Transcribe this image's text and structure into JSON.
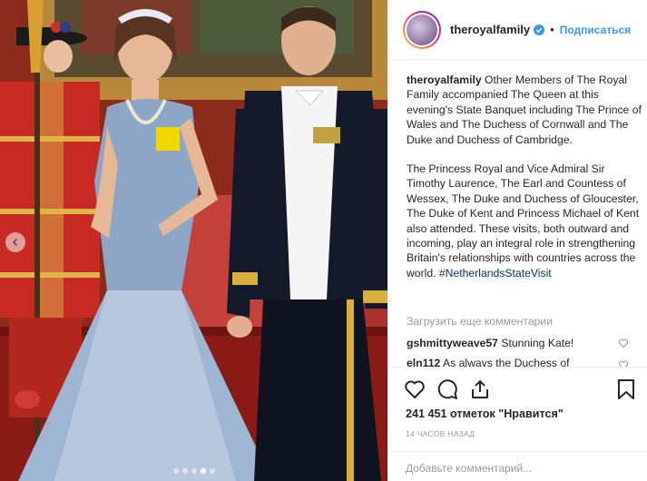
{
  "post": {
    "carousel": {
      "dots": 5,
      "active_index": 3
    }
  },
  "header": {
    "username": "theroyalfamily",
    "separator": "•",
    "follow_label": "Подписаться"
  },
  "caption": {
    "username": "theroyalfamily",
    "paragraph_1": "Other Members of The Royal Family accompanied The Queen at this evening's State Banquet including The Prince of Wales and The Duchess of Cornwall and The Duke and Duchess of Cambridge.",
    "paragraph_2": "The Princess Royal and Vice Admiral Sir Timothy Laurence, The Earl and Countess of Wessex, The Duke and Duchess of Gloucester, The Duke of Kent and Princess Michael of Kent also attended. These visits, both outward and incoming, play an integral role in strengthening Britain's relationships with countries across the world. ",
    "hashtag": "#NetherlandsStateVisit"
  },
  "comments": {
    "load_more": "Загрузить еще комментарии",
    "items": [
      {
        "user": "gshmittyweave57",
        "text": "Stunning Kate!"
      },
      {
        "user": "eln112",
        "text": "As always the Duchess of"
      }
    ]
  },
  "actions": {
    "likes": "241 451 отметок \"Нравится\"",
    "timestamp": "14 ЧАСОВ НАЗАД",
    "comment_placeholder": "Добавьте комментарий..."
  },
  "icons": [
    "heart-icon",
    "comment-icon",
    "share-icon",
    "bookmark-icon",
    "chevron-left-icon",
    "verified-icon"
  ],
  "colors": {
    "link": "#3897f0",
    "hashtag": "#003569",
    "muted": "#999999",
    "text": "#262626"
  }
}
